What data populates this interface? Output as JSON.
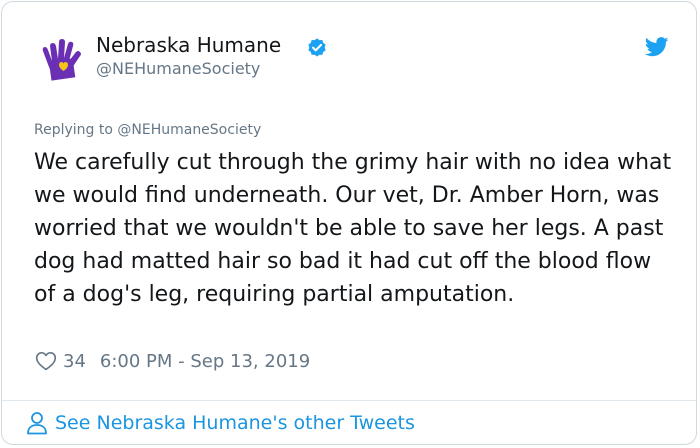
{
  "author": {
    "display_name": "Nebraska Humane",
    "handle": "@NEHumaneSociety",
    "verified": true,
    "logo_icon": "purple-hand-heart-logo"
  },
  "tweet": {
    "replying_to": "Replying to @NEHumaneSociety",
    "text": "We carefully cut through the grimy hair with no idea what we would find underneath. Our vet, Dr. Amber Horn, was worried that we wouldn't be able to save her legs. A past dog had matted hair so bad it had cut off the blood flow of a dog's leg, requiring partial amputation.",
    "like_count": "34",
    "timestamp": "6:00 PM - Sep 13, 2019"
  },
  "footer": {
    "see_more_label": "See Nebraska Humane's other Tweets"
  },
  "colors": {
    "brand_purple": "#6b2fb3",
    "brand_yellow": "#f5c518",
    "link_blue": "#1b95e0",
    "twitter_blue": "#1da1f2",
    "muted_gray": "#657786",
    "text_dark": "#14171a"
  }
}
